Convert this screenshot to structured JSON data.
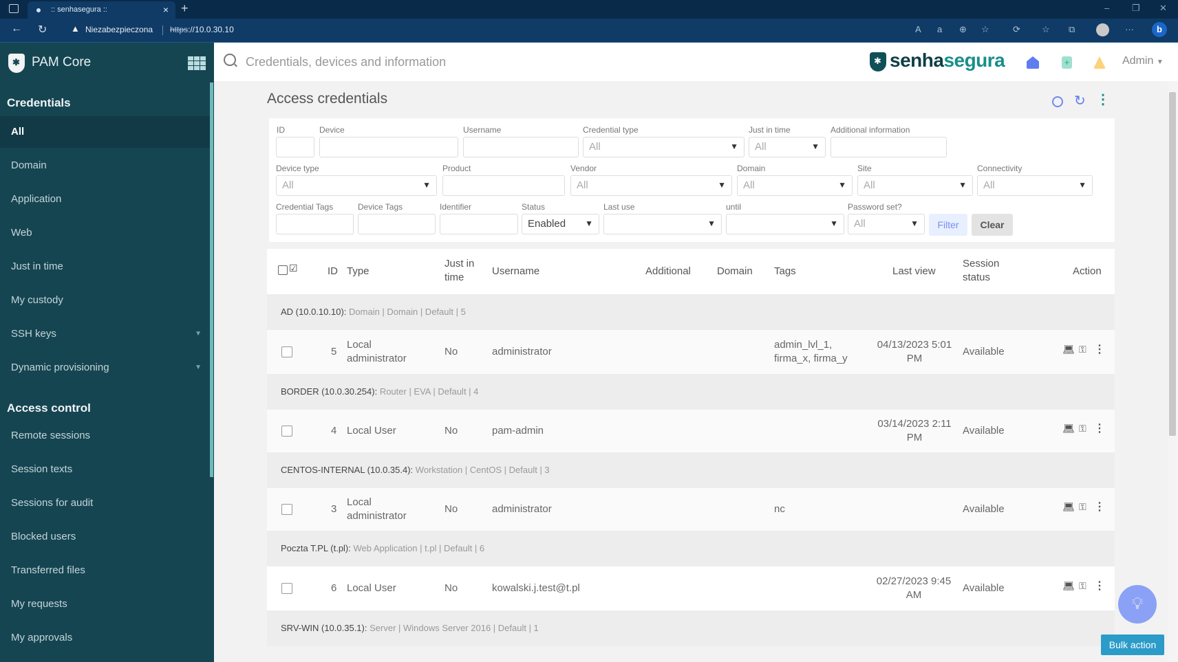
{
  "browser": {
    "tab_title": ":: senhasegura ::",
    "security_warning": "Niezabezpieczona",
    "url_scheme": "https",
    "url_rest": "://10.0.30.10"
  },
  "sidebar": {
    "app_name": "PAM Core",
    "sections": [
      {
        "title": "Credentials",
        "items": [
          {
            "label": "All",
            "active": true
          },
          {
            "label": "Domain"
          },
          {
            "label": "Application"
          },
          {
            "label": "Web"
          },
          {
            "label": "Just in time"
          },
          {
            "label": "My custody"
          },
          {
            "label": "SSH keys",
            "expandable": true
          },
          {
            "label": "Dynamic provisioning",
            "expandable": true
          }
        ]
      },
      {
        "title": "Access control",
        "items": [
          {
            "label": "Remote sessions"
          },
          {
            "label": "Session texts"
          },
          {
            "label": "Sessions for audit"
          },
          {
            "label": "Blocked users"
          },
          {
            "label": "Transferred files"
          },
          {
            "label": "My requests"
          },
          {
            "label": "My approvals"
          }
        ]
      }
    ]
  },
  "header": {
    "search_placeholder": "Credentials, devices and information",
    "brand_part1": "senha",
    "brand_part2": "segura",
    "user": "Admin"
  },
  "page": {
    "title": "Access credentials"
  },
  "filters": {
    "id": {
      "label": "ID",
      "value": ""
    },
    "device": {
      "label": "Device",
      "value": ""
    },
    "username": {
      "label": "Username",
      "value": ""
    },
    "credential_type": {
      "label": "Credential type",
      "value": "All"
    },
    "just_in_time": {
      "label": "Just in time",
      "value": "All"
    },
    "additional_information": {
      "label": "Additional information",
      "value": ""
    },
    "device_type": {
      "label": "Device type",
      "value": "All"
    },
    "product": {
      "label": "Product",
      "value": ""
    },
    "vendor": {
      "label": "Vendor",
      "value": "All"
    },
    "domain": {
      "label": "Domain",
      "value": "All"
    },
    "site": {
      "label": "Site",
      "value": "All"
    },
    "connectivity": {
      "label": "Connectivity",
      "value": "All"
    },
    "credential_tags": {
      "label": "Credential Tags",
      "value": ""
    },
    "device_tags": {
      "label": "Device Tags",
      "value": ""
    },
    "identifier": {
      "label": "Identifier",
      "value": ""
    },
    "status": {
      "label": "Status",
      "value": "Enabled"
    },
    "last_use": {
      "label": "Last use",
      "value": ""
    },
    "until": {
      "label": "until",
      "value": ""
    },
    "password_set": {
      "label": "Password set?",
      "value": "All"
    },
    "filter_button": "Filter",
    "clear_button": "Clear"
  },
  "table": {
    "columns": {
      "id": "ID",
      "type": "Type",
      "just_in_time": "Just in time",
      "username": "Username",
      "additional": "Additional",
      "domain": "Domain",
      "tags": "Tags",
      "last_view": "Last view",
      "session_status": "Session status",
      "action": "Action"
    },
    "groups": [
      {
        "device": "AD (10.0.10.10):",
        "meta": "Domain | Domain | Default | 5",
        "row": {
          "id": "5",
          "type": "Local administrator",
          "jit": "No",
          "username": "administrator",
          "additional": "",
          "domain": "",
          "tags": "admin_lvl_1, firma_x, firma_y",
          "last_view": "04/13/2023 5:01 PM",
          "session_status": "Available"
        }
      },
      {
        "device": "BORDER (10.0.30.254):",
        "meta": "Router | EVA | Default | 4",
        "row": {
          "id": "4",
          "type": "Local User",
          "jit": "No",
          "username": "pam-admin",
          "additional": "",
          "domain": "",
          "tags": "",
          "last_view": "03/14/2023 2:11 PM",
          "session_status": "Available"
        }
      },
      {
        "device": "CENTOS-INTERNAL (10.0.35.4):",
        "meta": "Workstation | CentOS | Default | 3",
        "row": {
          "id": "3",
          "type": "Local administrator",
          "jit": "No",
          "username": "administrator",
          "additional": "",
          "domain": "",
          "tags": "nc",
          "last_view": "",
          "session_status": "Available"
        }
      },
      {
        "device": "Poczta T.PL (t.pl):",
        "meta": "Web Application | t.pl | Default | 6",
        "row": {
          "id": "6",
          "type": "Local User",
          "jit": "No",
          "username": "kowalski.j.test@t.pl",
          "additional": "",
          "domain": "",
          "tags": "",
          "last_view": "02/27/2023 9:45 AM",
          "session_status": "Available"
        }
      },
      {
        "device": "SRV-WIN (10.0.35.1):",
        "meta": "Server | Windows Server 2016 | Default | 1"
      }
    ]
  },
  "bulk_action": "Bulk action",
  "colors": {
    "sidebar_bg": "#164552",
    "accent_teal": "#1a8e8a",
    "filter_btn": "#7b8ff0",
    "bulk_btn": "#2b9bc8",
    "fab": "#8aa1f5"
  }
}
